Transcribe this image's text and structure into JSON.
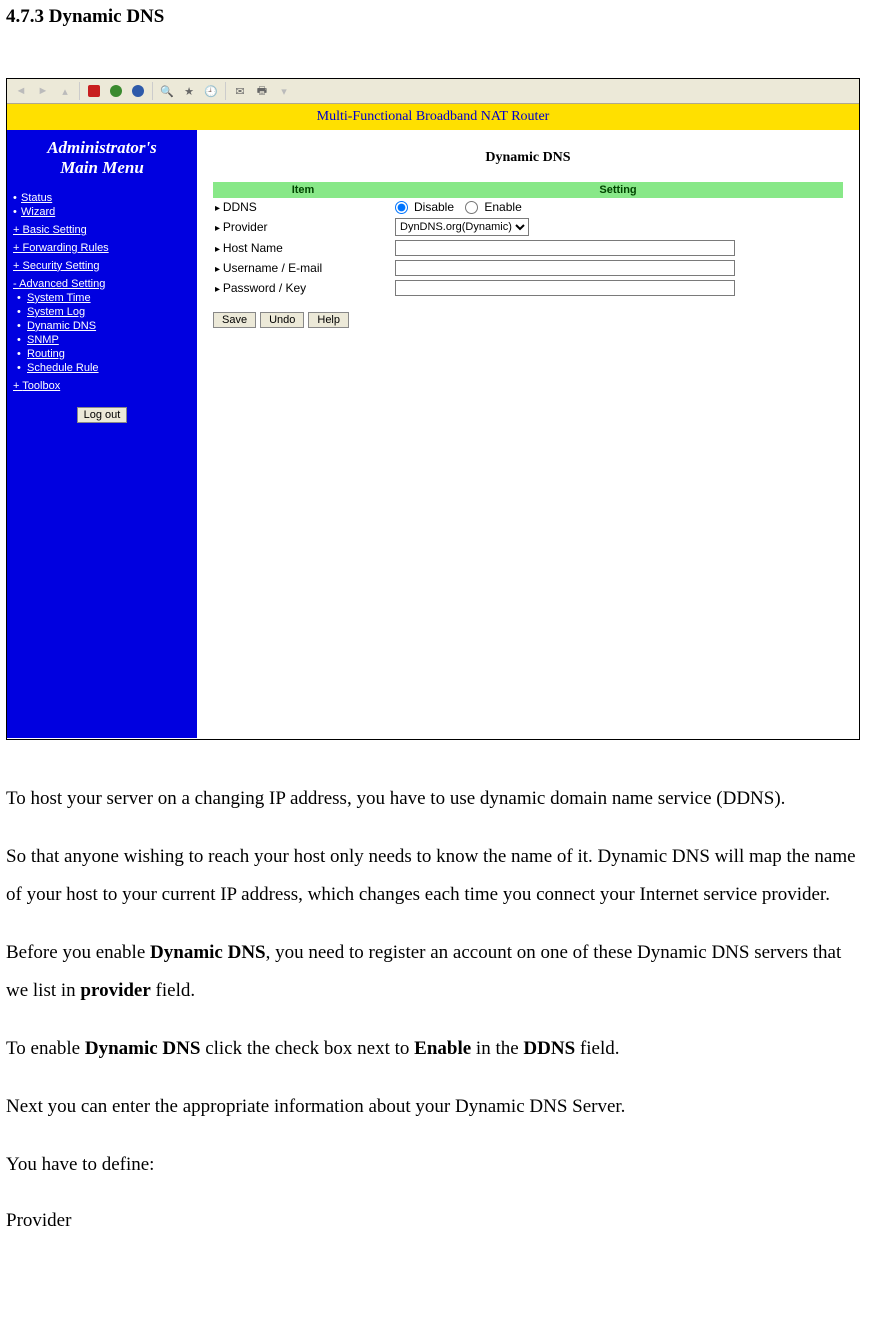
{
  "doc": {
    "heading": "4.7.3 Dynamic DNS",
    "para1": "To host your server on a changing IP address, you have to use dynamic domain name service (DDNS).",
    "para2": "So that anyone wishing to reach your host only needs to know the name of it. Dynamic DNS will map the name of your host to your current IP address, which changes each time you connect your Internet service provider.",
    "para3a": "Before you enable ",
    "para3b": "Dynamic DNS",
    "para3c": ", you need to register an account on one of these Dynamic DNS servers that we list in ",
    "para3d": "provider",
    "para3e": " field.",
    "para4a": "To enable ",
    "para4b": "Dynamic DNS",
    "para4c": " click the check box next to ",
    "para4d": "Enable",
    "para4e": " in the ",
    "para4f": "DDNS",
    "para4g": " field.",
    "para5": "Next you can enter the appropriate information about your Dynamic DNS Server.",
    "para6": "You have to define:",
    "para7": "Provider"
  },
  "router": {
    "banner": "Multi-Functional Broadband NAT Router",
    "sidebar": {
      "title_line1": "Administrator's",
      "title_line2": "Main Menu",
      "status": "Status",
      "wizard": "Wizard",
      "basic": "Basic Setting",
      "forwarding": "Forwarding Rules",
      "security": "Security Setting",
      "advanced": "Advanced Setting",
      "adv_items": {
        "systime": "System Time",
        "syslog": "System Log",
        "ddns": "Dynamic DNS",
        "snmp": "SNMP",
        "routing": "Routing",
        "schedule": "Schedule Rule"
      },
      "toolbox": "Toolbox",
      "logout": "Log out"
    },
    "content": {
      "title": "Dynamic DNS",
      "header_item": "Item",
      "header_setting": "Setting",
      "rows": {
        "ddns": "DDNS",
        "provider": "Provider",
        "hostname": "Host Name",
        "username": "Username / E-mail",
        "password": "Password / Key"
      },
      "ddns_disable": "Disable",
      "ddns_enable": "Enable",
      "provider_selected": "DynDNS.org(Dynamic)",
      "buttons": {
        "save": "Save",
        "undo": "Undo",
        "help": "Help"
      }
    }
  }
}
